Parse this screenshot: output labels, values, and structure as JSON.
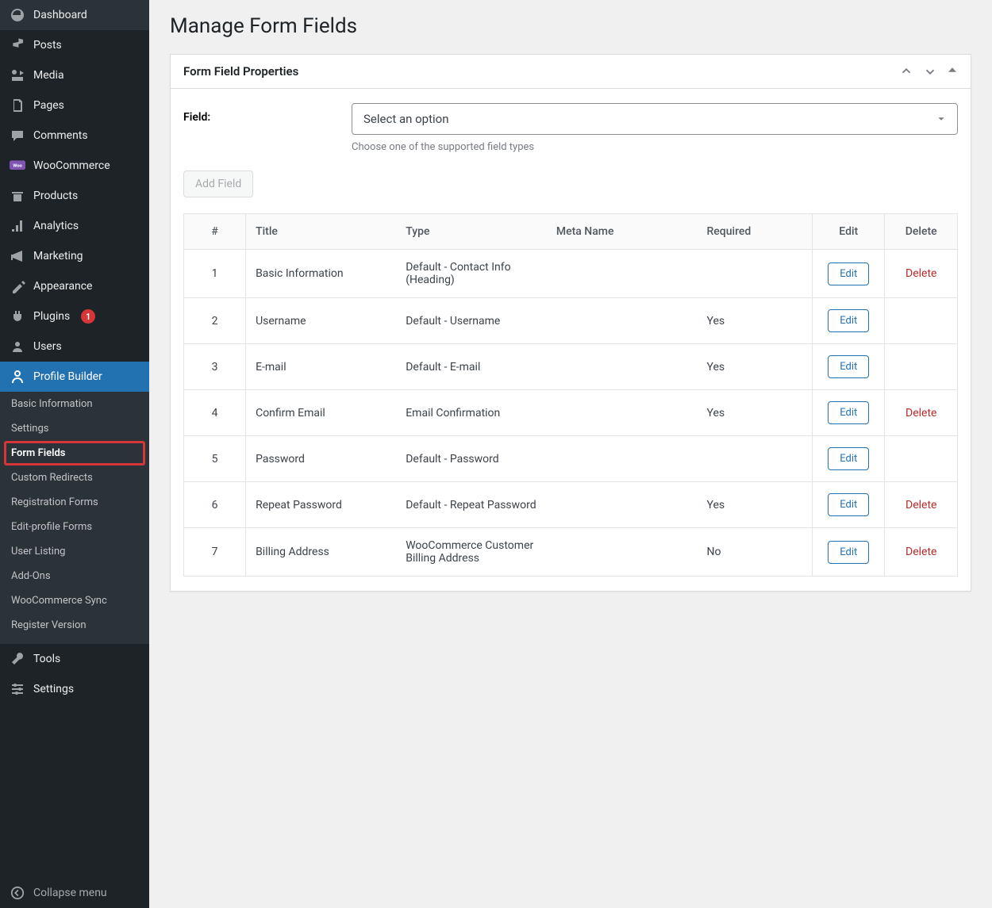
{
  "sidebar": {
    "main": [
      {
        "icon": "dashboard",
        "label": "Dashboard"
      },
      {
        "icon": "pin",
        "label": "Posts"
      },
      {
        "icon": "media",
        "label": "Media"
      },
      {
        "icon": "pages",
        "label": "Pages"
      },
      {
        "icon": "comments",
        "label": "Comments"
      },
      {
        "icon": "woo",
        "label": "WooCommerce"
      },
      {
        "icon": "products",
        "label": "Products"
      },
      {
        "icon": "analytics",
        "label": "Analytics"
      },
      {
        "icon": "marketing",
        "label": "Marketing"
      },
      {
        "icon": "appearance",
        "label": "Appearance"
      },
      {
        "icon": "plugins",
        "label": "Plugins",
        "badge": "1"
      },
      {
        "icon": "users",
        "label": "Users"
      },
      {
        "icon": "profile",
        "label": "Profile Builder",
        "active": true
      }
    ],
    "submenu": [
      {
        "label": "Basic Information"
      },
      {
        "label": "Settings"
      },
      {
        "label": "Form Fields",
        "current": true,
        "highlighted": true
      },
      {
        "label": "Custom Redirects"
      },
      {
        "label": "Registration Forms"
      },
      {
        "label": "Edit-profile Forms"
      },
      {
        "label": "User Listing"
      },
      {
        "label": "Add-Ons"
      },
      {
        "label": "WooCommerce Sync"
      },
      {
        "label": "Register Version"
      }
    ],
    "bottom": [
      {
        "icon": "tools",
        "label": "Tools"
      },
      {
        "icon": "settings",
        "label": "Settings"
      }
    ],
    "collapse_label": "Collapse menu"
  },
  "page": {
    "title": "Manage Form Fields",
    "panel_title": "Form Field Properties"
  },
  "field": {
    "label": "Field:",
    "select_text": "Select an option",
    "help": "Choose one of the supported field types",
    "add_button": "Add Field"
  },
  "table": {
    "headers": [
      "#",
      "Title",
      "Type",
      "Meta Name",
      "Required",
      "Edit",
      "Delete"
    ],
    "edit_label": "Edit",
    "delete_label": "Delete",
    "rows": [
      {
        "n": "1",
        "title": "Basic Information",
        "type": "Default - Contact Info (Heading)",
        "meta": "",
        "required": "",
        "deletable": true
      },
      {
        "n": "2",
        "title": "Username",
        "type": "Default - Username",
        "meta": "",
        "required": "Yes",
        "deletable": false
      },
      {
        "n": "3",
        "title": "E-mail",
        "type": "Default - E-mail",
        "meta": "",
        "required": "Yes",
        "deletable": false
      },
      {
        "n": "4",
        "title": "Confirm Email",
        "type": "Email Confirmation",
        "meta": "",
        "required": "Yes",
        "deletable": true
      },
      {
        "n": "5",
        "title": "Password",
        "type": "Default - Password",
        "meta": "",
        "required": "",
        "deletable": false
      },
      {
        "n": "6",
        "title": "Repeat Password",
        "type": "Default - Repeat Password",
        "meta": "",
        "required": "Yes",
        "deletable": true
      },
      {
        "n": "7",
        "title": "Billing Address",
        "type": "WooCommerce Customer Billing Address",
        "meta": "",
        "required": "No",
        "deletable": true
      }
    ]
  }
}
